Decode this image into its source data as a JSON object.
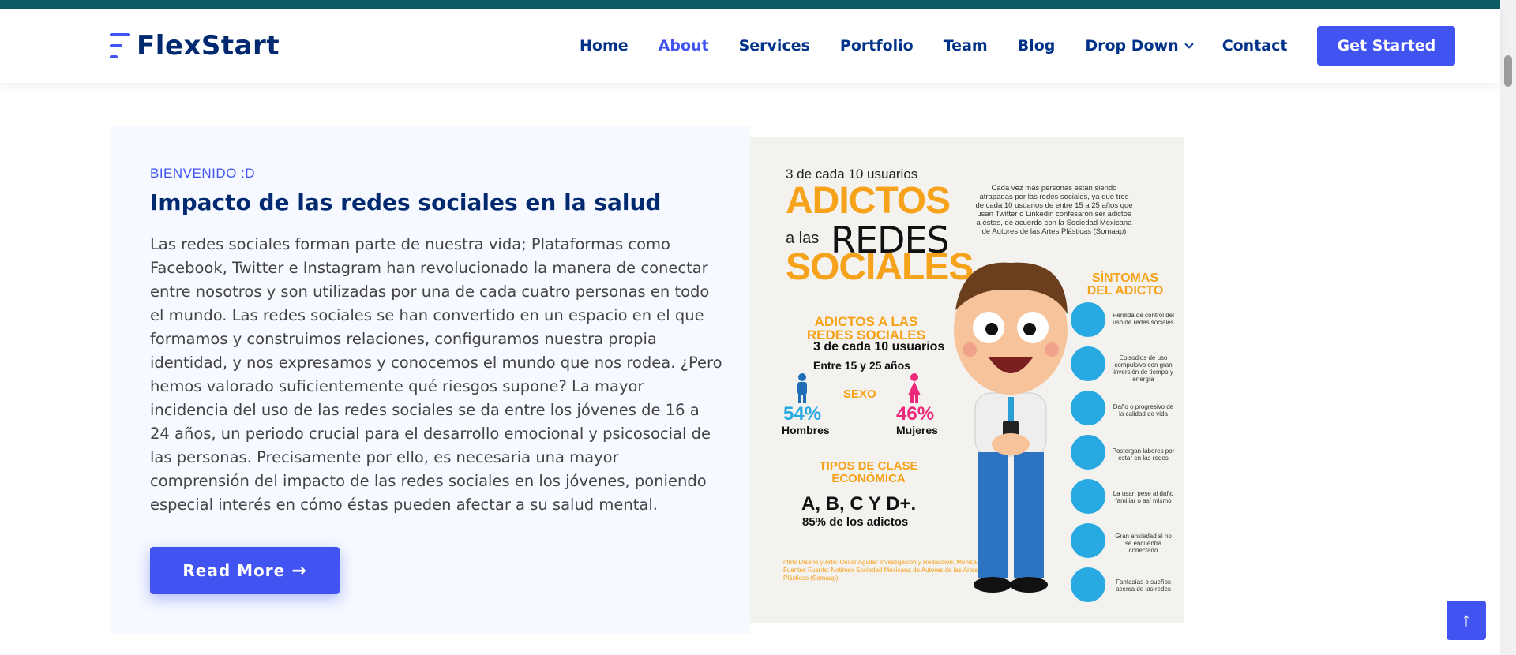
{
  "brand": {
    "name": "FlexStart",
    "accent": "#4154f1",
    "navy": "#012970"
  },
  "nav": {
    "items": [
      {
        "label": "Home"
      },
      {
        "label": "About"
      },
      {
        "label": "Services"
      },
      {
        "label": "Portfolio"
      },
      {
        "label": "Team"
      },
      {
        "label": "Blog"
      },
      {
        "label": "Drop Down"
      },
      {
        "label": "Contact"
      }
    ],
    "active": "About",
    "cta_label": "Get Started"
  },
  "about": {
    "eyebrow": "Bienvenido :D",
    "title": "Impacto de las redes sociales en la salud",
    "body": "Las redes sociales forman parte de nuestra vida; Plataformas como Facebook, Twitter e Instagram han revolucionado la manera de conectar entre nosotros y son utilizadas por una de cada cuatro personas en todo el mundo. Las redes sociales se han convertido en un espacio en el que formamos y construimos relaciones, configuramos nuestra propia identidad, y nos expresamos y conocemos el mundo que nos rodea. ¿Pero hemos valorado suficientemente qué riesgos supone? La mayor incidencia del uso de las redes sociales se da entre los jóvenes de 16 a 24 años, un periodo crucial para el desarrollo emocional y psicosocial de las personas. Precisamente por ello, es necesaria una mayor comprensión del impacto de las redes sociales en los jóvenes, poniendo especial interés en cómo éstas pueden afectar a su salud mental.",
    "read_more_label": "Read More"
  },
  "infographic": {
    "line1": "3 de cada 10 usuarios",
    "line2": "ADICTOS",
    "line3a": "a las",
    "line3b": "REDES",
    "line4": "SOCIALES",
    "description": "Cada vez más personas están siendo atrapadas por las redes sociales, ya que tres de cada 10 usuarios de entre 15 a 25 años que usan Twitter o Linkedin confesaron ser adictos a éstas, de acuerdo con la Sociedad Mexicana de Autores de las Artes Plásticas (Somaap)",
    "symptoms_title": "SÍNTOMAS DEL ADICTO",
    "adictos_title": "ADICTOS A LAS REDES SOCIALES",
    "stat_3de10": "3 de cada 10 usuarios",
    "age_range": "Entre 15 y 25 años",
    "sexo_label": "SEXO",
    "men_pct": "54%",
    "men_label": "Hombres",
    "women_pct": "46%",
    "women_label": "Mujeres",
    "clase_title": "TIPOS DE CLASE ECONÓMICA",
    "clases": "A, B, C Y D+.",
    "clases_pct": "85% de los adictos",
    "credits": "ntmx  Diseño y Arte: Oscar Aguilar  Investigación y Redacción: Mónica Fuentes  Fuente: Notimex  Sociedad Mexicana de Autores de las Artes Plásticas (Somaap)",
    "symptoms": [
      "Pérdida de control del uso de redes sociales",
      "Episodios de uso compulsivo con gran inversión de tiempo y energía",
      "Daño o progresivo de la calidad de vida",
      "Postergan labores por estar en las redes",
      "La usan pese al daño familiar o así mismo",
      "Gran ansiedad si no se encuentra conectado",
      "Fantasías o sueños acerca de las redes"
    ]
  },
  "icons": {
    "back_to_top": "arrow-up-icon",
    "dropdown": "chevron-down-icon",
    "read_more": "arrow-right-icon"
  }
}
